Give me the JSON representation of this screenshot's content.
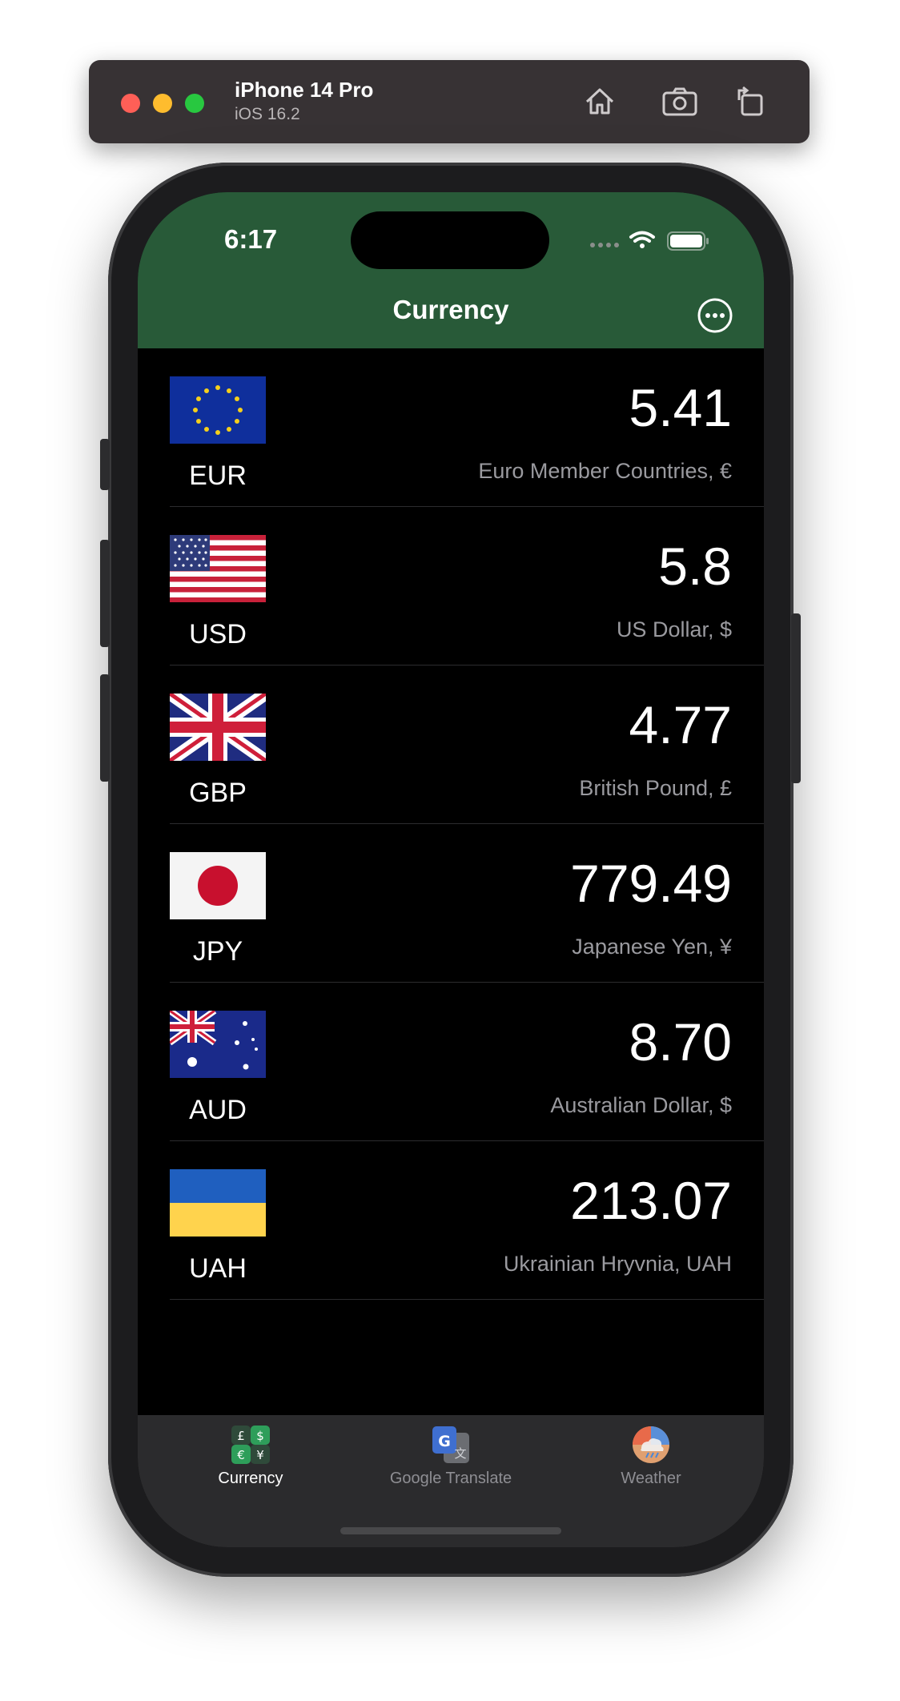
{
  "simulator": {
    "device_name": "iPhone 14 Pro",
    "os_version": "iOS 16.2",
    "icons": [
      "home-icon",
      "screenshot-icon",
      "rotate-icon"
    ]
  },
  "status_bar": {
    "time": "6:17",
    "icons": [
      "signal-icon",
      "wifi-icon",
      "battery-icon"
    ]
  },
  "header": {
    "title": "Currency",
    "accent_color": "#285a38",
    "more_icon": "ellipsis-circle-icon"
  },
  "currencies": [
    {
      "code": "EUR",
      "value": "5.41",
      "name": "Euro Member Countries, €",
      "flag": "eu-flag-icon"
    },
    {
      "code": "USD",
      "value": "5.8",
      "name": "US Dollar, $",
      "flag": "us-flag-icon"
    },
    {
      "code": "GBP",
      "value": "4.77",
      "name": "British Pound, £",
      "flag": "uk-flag-icon"
    },
    {
      "code": "JPY",
      "value": "779.49",
      "name": "Japanese Yen, ¥",
      "flag": "japan-flag-icon"
    },
    {
      "code": "AUD",
      "value": "8.70",
      "name": "Australian Dollar, $",
      "flag": "australia-flag-icon"
    },
    {
      "code": "UAH",
      "value": "213.07",
      "name": "Ukrainian Hryvnia, UAH",
      "flag": "ukraine-flag-icon"
    }
  ],
  "tabs": [
    {
      "label": "Currency",
      "icon": "currency-exchange-icon",
      "active": true
    },
    {
      "label": "Google Translate",
      "icon": "google-translate-icon",
      "active": false
    },
    {
      "label": "Weather",
      "icon": "weather-icon",
      "active": false
    }
  ],
  "colors": {
    "header_bg": "#285a38",
    "list_bg": "#000000",
    "secondary_text": "#9a9a9f",
    "tabbar_bg": "#2b2b2d"
  }
}
